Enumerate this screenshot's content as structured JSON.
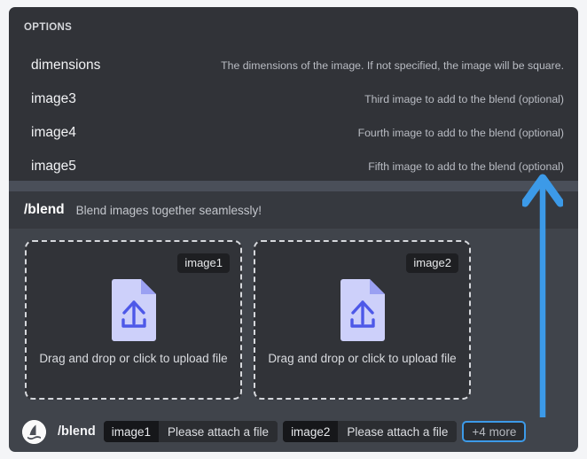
{
  "options": {
    "header": "OPTIONS",
    "rows": [
      {
        "name": "dimensions",
        "desc": "The dimensions of the image. If not specified, the image will be square."
      },
      {
        "name": "image3",
        "desc": "Third image to add to the blend (optional)"
      },
      {
        "name": "image4",
        "desc": "Fourth image to add to the blend (optional)"
      },
      {
        "name": "image5",
        "desc": "Fifth image to add to the blend (optional)"
      }
    ]
  },
  "blend_header": {
    "command": "/blend",
    "description": "Blend images together seamlessly!"
  },
  "dropzones": [
    {
      "badge": "image1",
      "caption": "Drag and drop or click to upload file",
      "icon": "file-upload-icon"
    },
    {
      "badge": "image2",
      "caption": "Drag and drop or click to upload file",
      "icon": "file-upload-icon"
    }
  ],
  "command_bar": {
    "avatar_icon": "midjourney-sailboat-avatar",
    "command": "/blend",
    "chips": [
      {
        "key": "image1",
        "value": "Please attach a file"
      },
      {
        "key": "image2",
        "value": "Please attach a file"
      }
    ],
    "more_label": "+4 more"
  },
  "annotation": {
    "arrow_icon": "up-arrow-annotation",
    "color": "#3c9ae8"
  },
  "colors": {
    "accent_blue": "#3c9ae8",
    "panel_dark": "#313338",
    "panel_mid": "#40444b",
    "panel_header": "#36393f",
    "chip_dark": "#16171a",
    "file_icon_purple": "#cdd0fa",
    "file_icon_arrow": "#5865f2"
  }
}
